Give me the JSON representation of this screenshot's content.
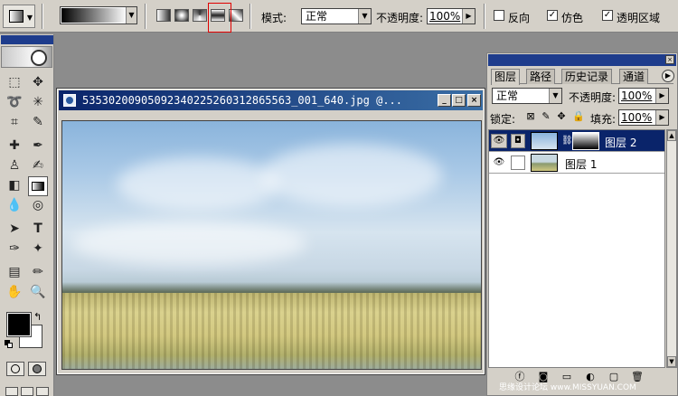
{
  "options_bar": {
    "mode_label": "模式:",
    "mode_value": "正常",
    "opacity_label": "不透明度:",
    "opacity_value": "100%",
    "reverse_label": "反向",
    "dither_label": "仿色",
    "transparency_label": "透明区域",
    "reverse_checked": "",
    "dither_checked": "✓",
    "transparency_checked": "✓",
    "gradient_types": [
      "linear",
      "radial",
      "angle",
      "reflected",
      "diamond"
    ],
    "selected_gradient_type": "reflected",
    "highlight_color": "#e00000"
  },
  "toolbox": {
    "foreground_color": "#000000",
    "background_color": "#ffffff",
    "selected_tool": "gradient-tool"
  },
  "document": {
    "title": "5353020090509234022526031286556З_001_640.jpg @...",
    "title_real": "53530200905092340225260312865563_001_640.jpg @...",
    "minimize": "_",
    "maximize": "□",
    "close": "×"
  },
  "layers_panel": {
    "tabs": [
      "图层",
      "路径",
      "历史记录",
      "通道"
    ],
    "active_tab": "图层",
    "blend_mode": "正常",
    "opacity_label": "不透明度:",
    "opacity_value": "100%",
    "lock_label": "锁定:",
    "fill_label": "填充:",
    "fill_value": "100%",
    "layers": [
      {
        "name": "图层 2",
        "visible": "👁",
        "selected": true,
        "has_mask": true
      },
      {
        "name": "图层 1",
        "visible": "👁",
        "selected": false,
        "has_mask": false
      }
    ]
  },
  "watermark": "思缘设计论坛 www.MISSYUAN.COM"
}
